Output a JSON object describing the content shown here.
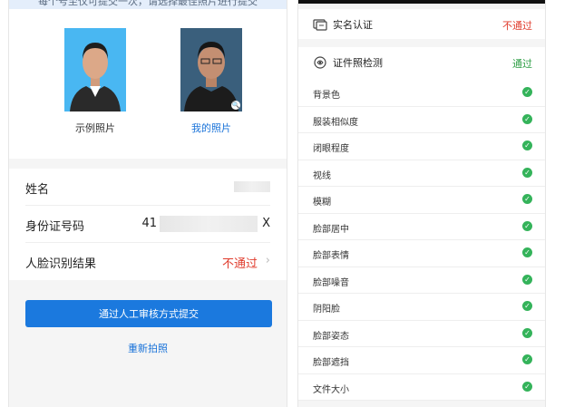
{
  "left": {
    "notice": "每个号至仅可提交一次，请选择最佳照片进行提交",
    "photos": [
      {
        "caption": "示例照片"
      },
      {
        "caption": "我的照片"
      }
    ],
    "info": {
      "name_label": "姓名",
      "id_label": "身份证号码",
      "id_prefix": "41",
      "id_suffix": "X",
      "face_label": "人脸识别结果",
      "face_value": "不通过"
    },
    "submit_label": "通过人工审核方式提交",
    "retake_label": "重新拍照"
  },
  "right": {
    "realname": {
      "title": "实名认证",
      "status": "不通过"
    },
    "photo_check": {
      "title": "证件照检测",
      "status": "通过"
    },
    "items": [
      "背景色",
      "服装相似度",
      "闭眼程度",
      "视线",
      "模糊",
      "脸部居中",
      "脸部表情",
      "脸部噪音",
      "阴阳脸",
      "脸部姿态",
      "脸部遮挡",
      "文件大小"
    ],
    "colors": {
      "pass": "#2e9e45",
      "fail": "#e03c2d",
      "accent": "#1b79de"
    }
  }
}
